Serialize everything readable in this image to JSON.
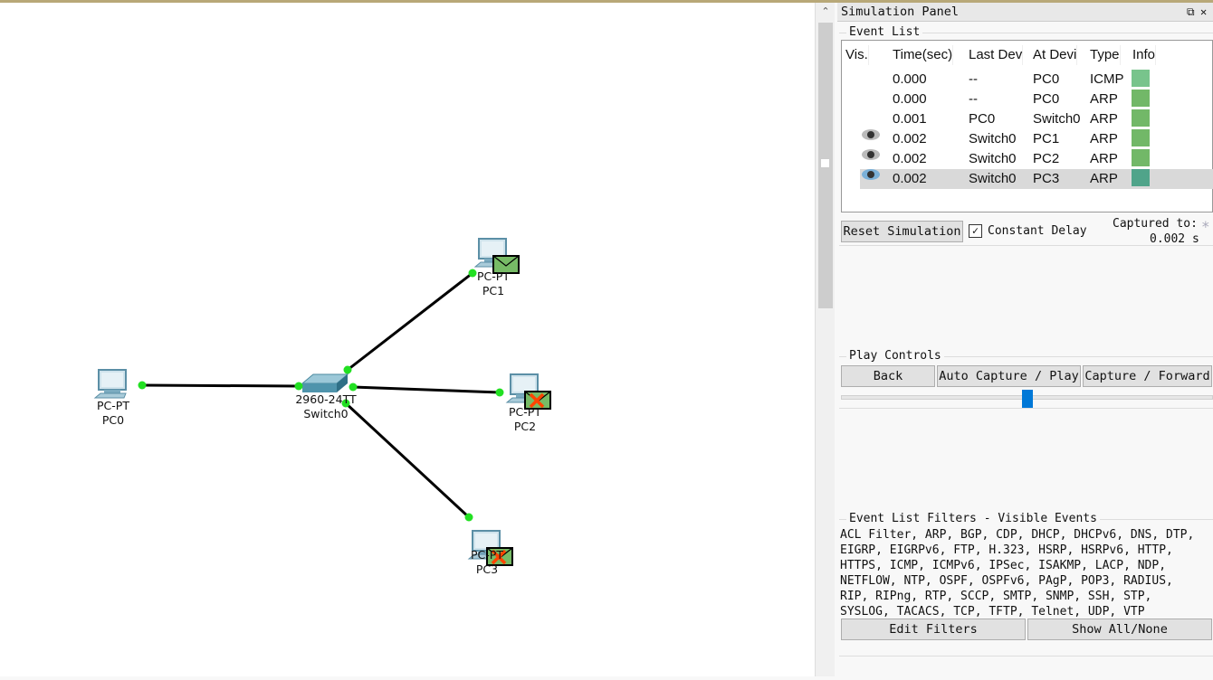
{
  "canvas": {
    "devices": [
      {
        "id": "pc0",
        "model": "PC-PT",
        "name": "PC0",
        "envelope": "none"
      },
      {
        "id": "switch0",
        "model": "2960-24TT",
        "name": "Switch0",
        "envelope": "none"
      },
      {
        "id": "pc1",
        "model": "PC-PT",
        "name": "PC1",
        "envelope": "ok"
      },
      {
        "id": "pc2",
        "model": "PC-PT",
        "name": "PC2",
        "envelope": "dropped"
      },
      {
        "id": "pc3",
        "model": "PC-PT",
        "name": "PC3",
        "envelope": "dropped"
      }
    ],
    "link_color": "#000000",
    "port_color": "#22e022",
    "envelope_color": "#77bb66",
    "drop_color": "#ff4400"
  },
  "panel": {
    "title": "Simulation Panel",
    "restore_icon": "restore-icon",
    "close_icon": "close-icon",
    "event_list": {
      "label": "Event List",
      "columns": [
        "Vis.",
        "Time(sec)",
        "Last Dev",
        "At Devi",
        "Type",
        "Info"
      ],
      "rows": [
        {
          "vis": "",
          "time": "0.000",
          "last": "--",
          "at": "PC0",
          "type": "ICMP",
          "info_color": "#78c48c"
        },
        {
          "vis": "",
          "time": "0.000",
          "last": "--",
          "at": "PC0",
          "type": "ARP",
          "info_color": "#72b868"
        },
        {
          "vis": "",
          "time": "0.001",
          "last": "PC0",
          "at": "Switch0",
          "type": "ARP",
          "info_color": "#72b868"
        },
        {
          "vis": "eye",
          "time": "0.002",
          "last": "Switch0",
          "at": "PC1",
          "type": "ARP",
          "info_color": "#72b868"
        },
        {
          "vis": "eye",
          "time": "0.002",
          "last": "Switch0",
          "at": "PC2",
          "type": "ARP",
          "info_color": "#72b868"
        },
        {
          "vis": "eye-selected",
          "time": "0.002",
          "last": "Switch0",
          "at": "PC3",
          "type": "ARP",
          "info_color": "#50a48a"
        }
      ]
    },
    "reset_label": "Reset Simulation",
    "constant_delay_label": "Constant Delay",
    "constant_delay_checked": true,
    "captured_label": "Captured to:",
    "captured_value": "0.002 s",
    "play_controls": {
      "label": "Play Controls",
      "back": "Back",
      "auto": "Auto Capture / Play",
      "forward": "Capture / Forward",
      "slider_percent": 50
    },
    "filters": {
      "label": "Event List Filters - Visible Events",
      "lines": [
        "ACL Filter, ARP, BGP, CDP, DHCP, DHCPv6, DNS, DTP,",
        "EIGRP, EIGRPv6, FTP, H.323, HSRP, HSRPv6, HTTP,",
        "HTTPS, ICMP, ICMPv6, IPSec, ISAKMP, LACP, NDP,",
        "NETFLOW, NTP, OSPF, OSPFv6, PAgP, POP3, RADIUS,",
        "RIP, RIPng, RTP, SCCP, SMTP, SNMP, SSH, STP,",
        "SYSLOG, TACACS, TCP, TFTP, Telnet, UDP, VTP"
      ],
      "edit": "Edit Filters",
      "show_all": "Show All/None"
    }
  }
}
